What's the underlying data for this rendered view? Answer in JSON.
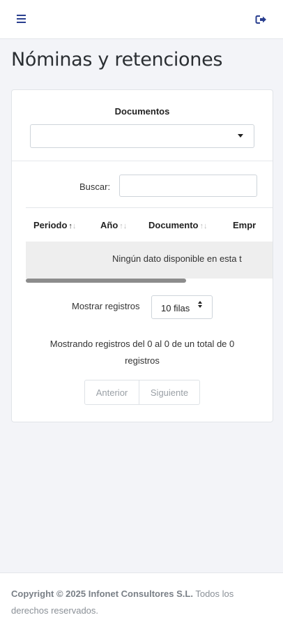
{
  "page": {
    "title": "Nóminas y retenciones"
  },
  "header": {
    "menu_icon": "hamburger-menu-icon",
    "logout_icon": "logout-icon",
    "accent_color": "#2a3f8f"
  },
  "documents": {
    "label": "Documentos",
    "selected": ""
  },
  "table": {
    "search_label": "Buscar:",
    "search_value": "",
    "columns": [
      "Periodo",
      "Año",
      "Documento",
      "Empr"
    ],
    "empty_message": "Ningún dato disponible en esta t",
    "rows_label": "Mostrar registros",
    "rows_value": "10 filas",
    "info": "Mostrando registros del 0 al 0 de un total de 0 registros",
    "pagination": {
      "previous": "Anterior",
      "next": "Siguiente"
    }
  },
  "footer": {
    "copyright": "Copyright © 2025 Infonet Consultores S.L.",
    "rights": "Todos los derechos reservados."
  }
}
